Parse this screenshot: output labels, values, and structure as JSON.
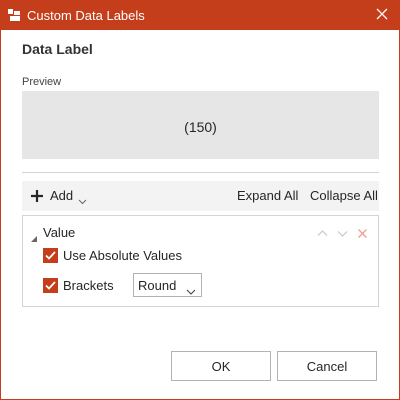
{
  "titlebar": {
    "title": "Custom Data Labels",
    "icon": "chart-label-icon",
    "color": "#c43e1c"
  },
  "dialog": {
    "section_title": "Data Label",
    "preview_label": "Preview",
    "preview_value": "(150)"
  },
  "toolbar": {
    "add_label": "Add",
    "expand_all": "Expand All",
    "collapse_all": "Collapse All"
  },
  "tree": {
    "node_label": "Value",
    "options": [
      {
        "label": "Use Absolute Values",
        "checked": true
      },
      {
        "label": "Brackets",
        "checked": true
      }
    ],
    "brackets_select": {
      "value": "Round"
    }
  },
  "buttons": {
    "ok": "OK",
    "cancel": "Cancel"
  }
}
